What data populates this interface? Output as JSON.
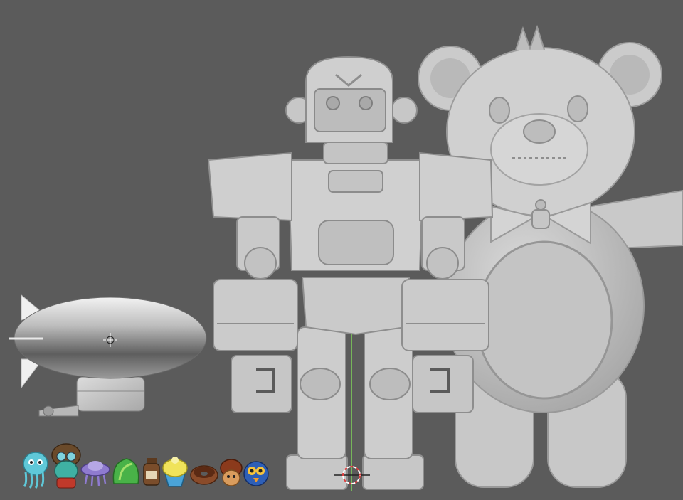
{
  "scene": {
    "background_color": "#5b5b5b",
    "model_color": "#cfcfcf",
    "model_shadow": "#a9a9a9",
    "objects": [
      "airship",
      "robot",
      "teddy-bear"
    ],
    "icons": [
      {
        "name": "jellyfish-blue-icon",
        "color": "#5fc8d8"
      },
      {
        "name": "pilot-character-icon",
        "color": "#6a4a2a"
      },
      {
        "name": "ufo-jellyfish-icon",
        "color": "#8f7bd0"
      },
      {
        "name": "leaf-plant-icon",
        "color": "#49b248"
      },
      {
        "name": "potion-bottle-icon",
        "color": "#7a4d2b"
      },
      {
        "name": "cupcake-icon",
        "color": "#f0e35b"
      },
      {
        "name": "donut-icon",
        "color": "#8a4b2a"
      },
      {
        "name": "acorn-character-icon",
        "color": "#8b3a1c"
      },
      {
        "name": "blue-bird-icon",
        "color": "#2e5fb7"
      }
    ],
    "gizmo": {
      "axis_color": "#7fd35a",
      "cursor_color": "#e03b3b"
    }
  }
}
